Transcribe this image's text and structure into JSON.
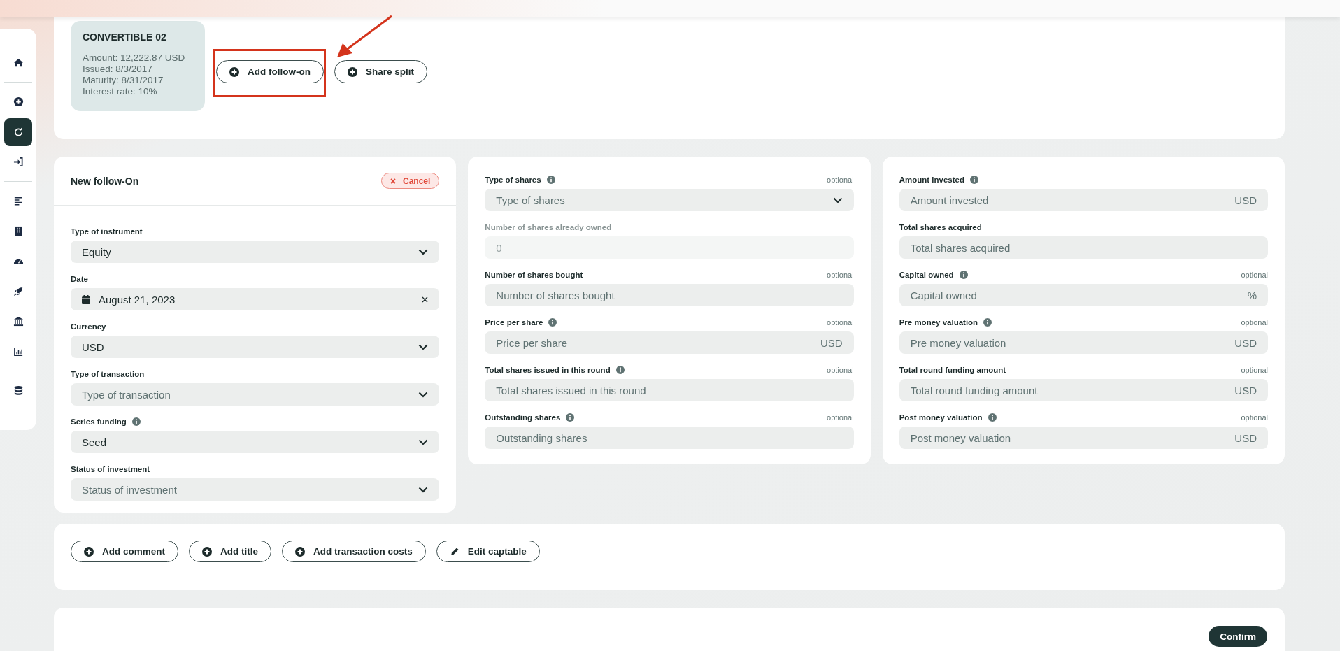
{
  "sidebar": {
    "groups": [
      [
        {
          "selected": false
        }
      ],
      [
        {
          "selected": false
        },
        {
          "selected": true
        },
        {
          "selected": false
        }
      ],
      [
        {
          "selected": false
        },
        {
          "selected": false
        },
        {
          "selected": false
        },
        {
          "selected": false
        },
        {
          "selected": false
        },
        {
          "selected": false
        }
      ],
      [
        {
          "selected": false
        }
      ]
    ]
  },
  "instrument": {
    "title": "CONVERTIBLE 02",
    "lines": [
      "Amount: 12,222.87 USD",
      "Issued: 8/3/2017",
      "Maturity: 8/31/2017",
      "Interest rate: 10%"
    ]
  },
  "top_actions": [
    {
      "label": "Add follow-on",
      "kind": "add"
    },
    {
      "label": "Share split",
      "kind": "add"
    }
  ],
  "follow_on": {
    "title": "New follow-On",
    "cancel": "Cancel",
    "fields": [
      {
        "label": "Type of instrument",
        "info": false,
        "kind": "select",
        "value": "Equity",
        "disabled": false
      },
      {
        "label": "Date",
        "info": false,
        "kind": "date",
        "value": "August 21, 2023",
        "disabled": false
      },
      {
        "label": "Currency",
        "info": false,
        "kind": "select",
        "value": "USD",
        "disabled": false
      },
      {
        "label": "Type of transaction",
        "info": false,
        "kind": "select",
        "placeholder": "Type of transaction",
        "disabled": false
      },
      {
        "label": "Series funding",
        "info": true,
        "kind": "select",
        "value": "Seed",
        "disabled": false
      },
      {
        "label": "Status of investment",
        "info": false,
        "kind": "select",
        "placeholder": "Status of investment",
        "disabled": false
      }
    ]
  },
  "shares": {
    "fields": [
      {
        "label": "Type of shares",
        "info": true,
        "note": "optional",
        "kind": "select",
        "placeholder": "Type of shares",
        "disabled": false
      },
      {
        "label": "Number of shares already owned",
        "info": false,
        "kind": "text",
        "value": "0",
        "disabled": true
      },
      {
        "label": "Number of shares bought",
        "info": false,
        "note": "optional",
        "kind": "text",
        "placeholder": "Number of shares bought",
        "disabled": false
      },
      {
        "label": "Price per share",
        "info": true,
        "note": "optional",
        "kind": "text",
        "placeholder": "Price per share",
        "unit": "USD",
        "disabled": false
      },
      {
        "label": "Total shares issued in this round",
        "info": true,
        "note": "optional",
        "kind": "text",
        "placeholder": "Total shares issued in this round",
        "disabled": false
      },
      {
        "label": "Outstanding shares",
        "info": true,
        "note": "optional",
        "kind": "text",
        "placeholder": "Outstanding shares",
        "disabled": false
      }
    ]
  },
  "investment": {
    "fields": [
      {
        "label": "Amount invested",
        "info": true,
        "kind": "text",
        "placeholder": "Amount invested",
        "unit": "USD",
        "disabled": false
      },
      {
        "label": "Total shares acquired",
        "info": false,
        "kind": "text",
        "placeholder": "Total shares acquired",
        "disabled": false
      },
      {
        "label": "Capital owned",
        "info": true,
        "note": "optional",
        "kind": "text",
        "placeholder": "Capital owned",
        "unit": "%",
        "disabled": false
      },
      {
        "label": "Pre money valuation",
        "info": true,
        "note": "optional",
        "kind": "text",
        "placeholder": "Pre money valuation",
        "unit": "USD",
        "disabled": false
      },
      {
        "label": "Total round funding amount",
        "info": false,
        "note": "optional",
        "kind": "text",
        "placeholder": "Total round funding amount",
        "unit": "USD",
        "disabled": false
      },
      {
        "label": "Post money valuation",
        "info": true,
        "note": "optional",
        "kind": "text",
        "placeholder": "Post money valuation",
        "unit": "USD",
        "disabled": false
      }
    ]
  },
  "bottom_actions": [
    {
      "label": "Add comment",
      "kind": "add"
    },
    {
      "label": "Add title",
      "kind": "add"
    },
    {
      "label": "Add transaction costs",
      "kind": "add"
    },
    {
      "label": "Edit captable",
      "kind": "edit"
    }
  ],
  "confirm": "Confirm"
}
